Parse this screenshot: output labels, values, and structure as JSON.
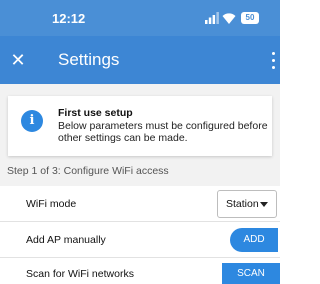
{
  "status_bar": {
    "time": "12:12",
    "battery_label": "50",
    "icons": [
      "signal-icon",
      "wifi-icon",
      "battery-icon"
    ]
  },
  "app_bar": {
    "title": "Settings",
    "close_glyph": "✕",
    "icons": [
      "close-icon",
      "more-vert-icon"
    ],
    "color": "#3d86d4"
  },
  "info_card": {
    "icon_glyph": "i",
    "title": "First use setup",
    "body": "Below parameters must be configured before other settings can be made."
  },
  "section": {
    "header": "Step 1 of 3: Configure WiFi access"
  },
  "rows": {
    "wifi_mode": {
      "label": "WiFi mode",
      "value": "Station"
    },
    "add_ap": {
      "label": "Add AP manually",
      "button": "ADD"
    },
    "scan": {
      "label": "Scan for WiFi networks",
      "button": "SCAN"
    }
  },
  "accent_color": "#2d88e0"
}
